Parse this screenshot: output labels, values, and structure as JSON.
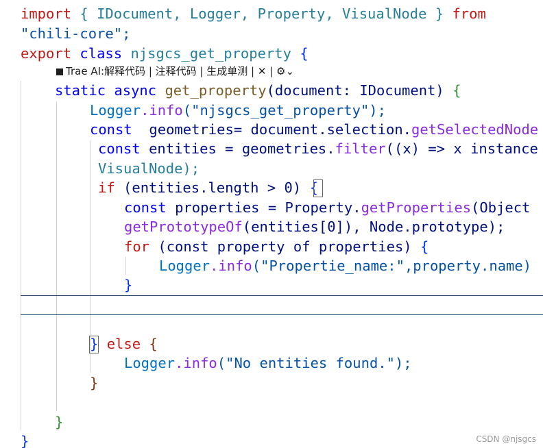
{
  "code": {
    "l1_import": "import",
    "l1_names": "{ IDocument, Logger, Property, VisualNode }",
    "l1_from": "from",
    "l2_module": "\"chili-core\";",
    "l3_export": "export",
    "l3_class": "class",
    "l3_name": "njsgcs_get_property",
    "l3_brace": "{",
    "l4_static": "static",
    "l4_async": "async",
    "l4_fn": "get_property",
    "l4_param": "(document: IDocument)",
    "l4_brace": "{",
    "l5_logger": "Logger",
    "l5_info": ".info",
    "l5_arg": "(\"njsgcs_get_property\");",
    "l6_const": "const",
    "l6_var": "geometries=",
    "l6_expr": "document.selection.",
    "l6_call": "getSelectedNode",
    "l7_const": "const",
    "l7_var": "entities",
    "l7_eq": " = geometries.",
    "l7_filter": "filter",
    "l7_rest": "((x) => x instance",
    "l8_text": "VisualNode);",
    "l9_if": "if",
    "l9_cond": "(entities.length > 0)",
    "l9_brace": "{",
    "l10_const": "const",
    "l10_var": "properties",
    "l10_eq": " = Property.",
    "l10_call": "getProperties",
    "l10_rest": "(Object",
    "l11_call": "getPrototypeOf",
    "l11_rest": "(entities[0]), Node.prototype);",
    "l12_for": "for",
    "l12_rest": "(const property of properties)",
    "l12_brace": "{",
    "l13_logger": "Logger",
    "l13_info": ".info",
    "l13_rest": "(\"Propertie_name:\",property.name)",
    "l14_close": "}",
    "l17_close": "}",
    "l17_else": "else",
    "l17_brace": "{",
    "l18_logger": "Logger",
    "l18_info": ".info",
    "l18_rest": "(\"No entities found.\");",
    "l19_close": "}",
    "l21_close": "}",
    "l22_close": "}"
  },
  "codelens": {
    "text": "Trae AI:解释代码 | 注释代码 | 生成单测 | ✕ |",
    "icon": "trae-icon",
    "chevron": "⌄"
  },
  "watermark": "CSDN @njsgcs"
}
